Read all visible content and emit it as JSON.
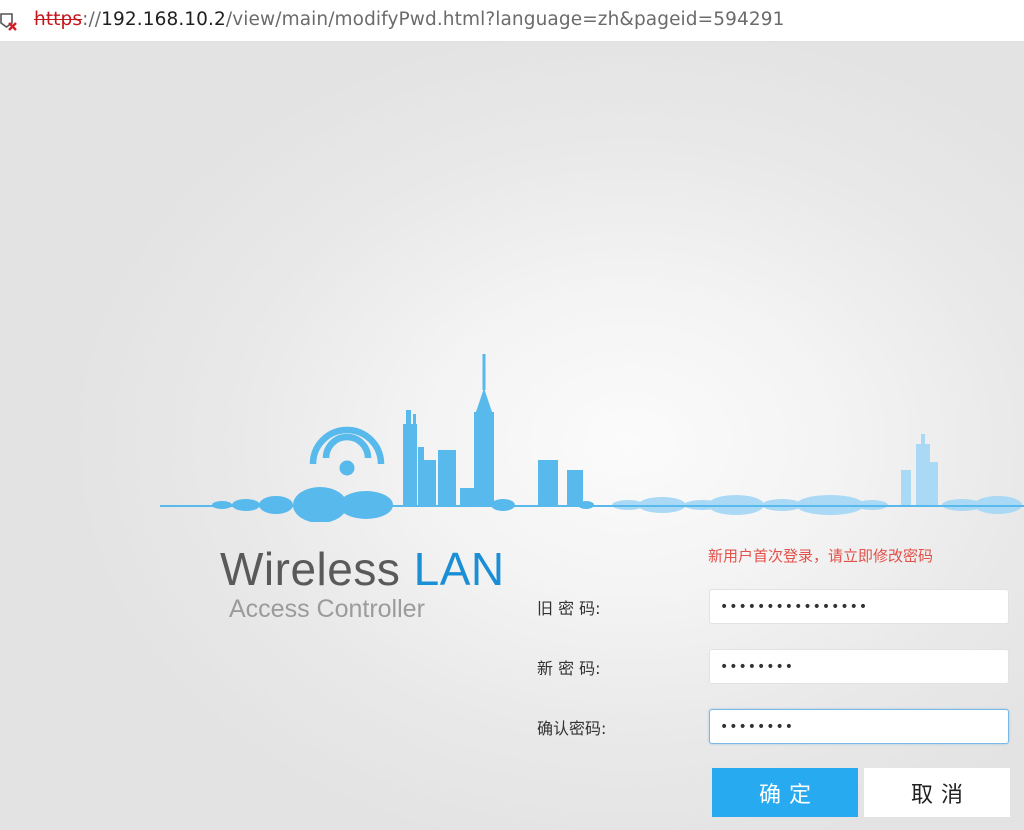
{
  "browser": {
    "url_scheme": "https",
    "url_separator": "://",
    "url_host": "192.168.10.2",
    "url_path": "/view/main/modifyPwd.html?language=zh&pageid=594291"
  },
  "brand": {
    "title_main": "Wireless",
    "title_accent": "LAN",
    "subtitle": "Access Controller",
    "accent_color": "#1b8fd6"
  },
  "form": {
    "notice": "新用户首次登录，请立即修改密码",
    "old_password": {
      "label": "旧 密 码:",
      "value": "••••••••••••••••"
    },
    "new_password": {
      "label": "新 密 码:",
      "value": "••••••••"
    },
    "confirm_password": {
      "label": "确认密码:",
      "value": "••••••••"
    },
    "ok_label": "确定",
    "cancel_label": "取消",
    "ok_color": "#28aaf0"
  }
}
